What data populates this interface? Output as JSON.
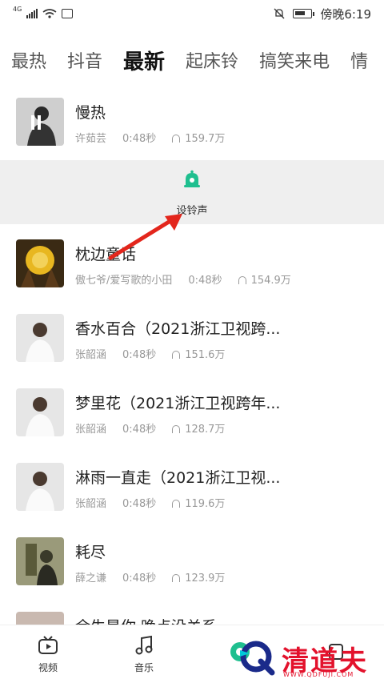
{
  "status_bar": {
    "network": "4G",
    "time": "傍晚6:19",
    "icons": [
      "signal-icon",
      "wifi-icon",
      "notification-icon",
      "mute-icon",
      "battery-icon"
    ]
  },
  "tabs": [
    {
      "label": "最热"
    },
    {
      "label": "抖音"
    },
    {
      "label": "最新",
      "active": true
    },
    {
      "label": "起床铃"
    },
    {
      "label": "搞笑来电"
    },
    {
      "label": "情"
    }
  ],
  "ringtone_panel": {
    "label": "设铃声"
  },
  "songs": [
    {
      "title": "慢热",
      "artist": "许茹芸",
      "duration": "0:48秒",
      "plays": "159.7万"
    },
    {
      "title": "枕边童话",
      "artist": "傲七爷/爱写歌的小田",
      "duration": "0:48秒",
      "plays": "154.9万"
    },
    {
      "title": "香水百合（2021浙江卫视跨...",
      "artist": "张韶涵",
      "duration": "0:48秒",
      "plays": "151.6万"
    },
    {
      "title": "梦里花（2021浙江卫视跨年...",
      "artist": "张韶涵",
      "duration": "0:48秒",
      "plays": "128.7万"
    },
    {
      "title": "淋雨一直走（2021浙江卫视...",
      "artist": "张韶涵",
      "duration": "0:48秒",
      "plays": "119.6万"
    },
    {
      "title": "耗尽",
      "artist": "薛之谦",
      "duration": "0:48秒",
      "plays": "123.9万"
    },
    {
      "title": "余生是你 晚点没关系",
      "artist": "",
      "duration": "",
      "plays": ""
    }
  ],
  "bottom_nav": [
    {
      "label": "视频",
      "icon": "tv-icon"
    },
    {
      "label": "音乐",
      "icon": "music-note-icon"
    },
    {
      "label": "",
      "icon": "ring-icon"
    },
    {
      "label": "",
      "icon": "profile-icon"
    }
  ],
  "watermark": {
    "text": "清道夫",
    "url": "WWW.QDFUJI.COM"
  },
  "colors": {
    "accent": "#1fbf8f",
    "arrow": "#e3261c",
    "watermark": "#e3122c"
  }
}
